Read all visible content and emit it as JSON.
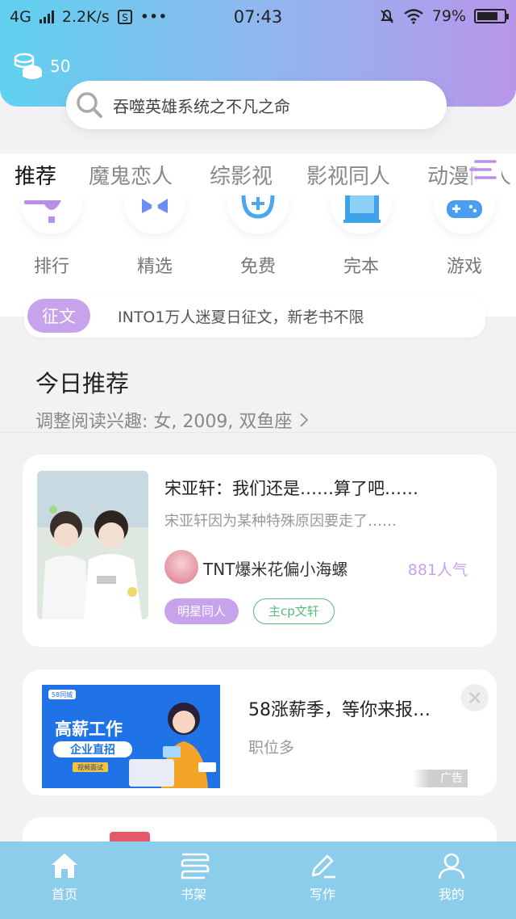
{
  "status_bar": {
    "network": "4G",
    "speed": "2.2K/s",
    "extra": "•••",
    "time": "07:43",
    "battery": "79%",
    "battery_level": 0.79
  },
  "header": {
    "coin_count": "50",
    "search_placeholder": "吞噬英雄系统之不凡之命"
  },
  "tabs": [
    "推荐",
    "魔鬼恋人",
    "综影视",
    "影视同人",
    "动漫同人"
  ],
  "categories": [
    {
      "label": "排行",
      "icon": "trophy-icon",
      "color": "#b88fe6"
    },
    {
      "label": "精选",
      "icon": "bow-icon",
      "color": "#6b8ef0"
    },
    {
      "label": "免费",
      "icon": "plus-circle-icon",
      "color": "#4aa8ee"
    },
    {
      "label": "完本",
      "icon": "screen-icon",
      "color": "#3fa2ea"
    },
    {
      "label": "游戏",
      "icon": "gamepad-icon",
      "color": "#4a9ef0"
    }
  ],
  "notice": {
    "badge": "征文",
    "text": "INTO1万人迷夏日征文，新老书不限"
  },
  "today": {
    "title": "今日推荐",
    "subtitle": "调整阅读兴趣: 女, 2009, 双鱼座"
  },
  "book": {
    "title": "宋亚轩：我们还是……算了吧……",
    "description": "宋亚轩因为某种特殊原因要走了……",
    "author": "TNT爆米花偏小海螺",
    "popularity": "881人气",
    "tags": [
      "明星同人",
      "主cp文轩"
    ]
  },
  "ad": {
    "title": "58涨薪季，等你来报…",
    "subtitle": "职位多",
    "label": "广告",
    "image_brand": "58同城",
    "image_title": "高薪工作",
    "image_sub": "企业直招",
    "image_small": "视频面试"
  },
  "tabbar": [
    {
      "label": "首页",
      "icon": "home-icon"
    },
    {
      "label": "书架",
      "icon": "bookshelf-icon"
    },
    {
      "label": "写作",
      "icon": "pen-icon"
    },
    {
      "label": "我的",
      "icon": "user-icon"
    }
  ]
}
